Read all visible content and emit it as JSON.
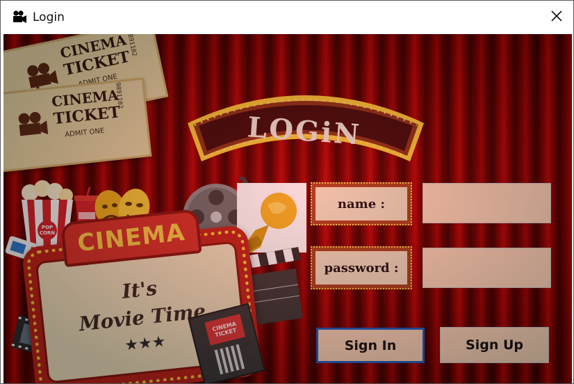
{
  "window": {
    "title": "Login",
    "app_icon": "movie-camera-icon",
    "close_icon": "close-icon"
  },
  "banner": {
    "title": "LOGiN"
  },
  "tickets": [
    {
      "line1": "CINEMA",
      "line2": "TICKET",
      "admit": "ADMIT ONE",
      "number": "9891102"
    },
    {
      "line1": "CINEMA",
      "line2": "TICKET",
      "admit": "ADMIT ONE",
      "number": "9891102"
    }
  ],
  "sign": {
    "header": "CINEMA",
    "line1": "It's",
    "line2": "Movie Time",
    "stars": "★★★"
  },
  "popcorn": {
    "label": "POP CORN"
  },
  "small_ticket": {
    "label": "CINEMA TICKET"
  },
  "form": {
    "name_label": "name :",
    "password_label": "password :",
    "name_value": "",
    "password_value": ""
  },
  "buttons": {
    "sign_in": "Sign In",
    "sign_up": "Sign Up"
  },
  "colors": {
    "curtain": "#8b0000",
    "field_bg": "#fedcc0",
    "focus_border": "#1e63c6",
    "label_frame": "#a5421c"
  }
}
